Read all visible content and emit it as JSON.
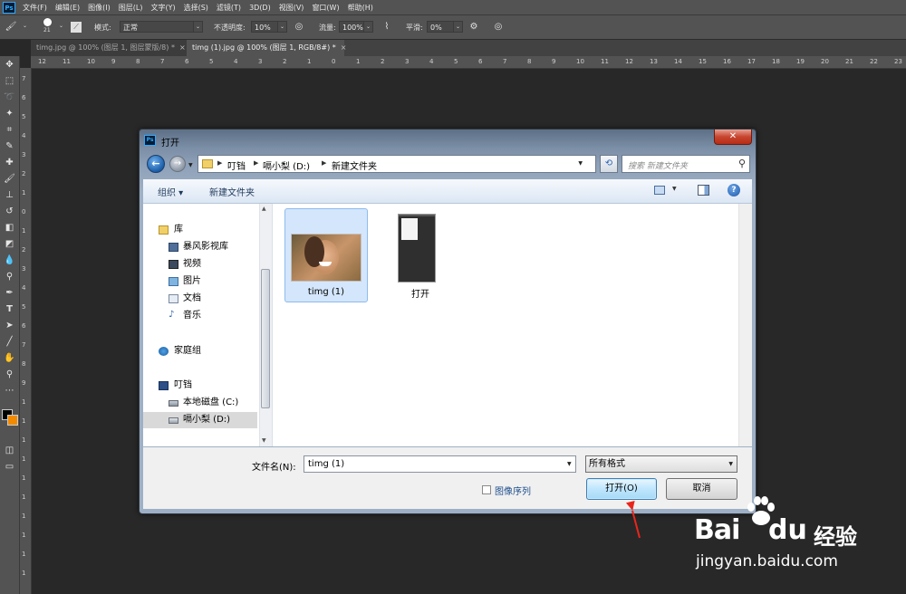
{
  "app": {
    "logo": "Ps",
    "menu": [
      "文件(F)",
      "编辑(E)",
      "图像(I)",
      "图层(L)",
      "文字(Y)",
      "选择(S)",
      "滤镜(T)",
      "3D(D)",
      "视图(V)",
      "窗口(W)",
      "帮助(H)"
    ]
  },
  "options": {
    "brush_size": "21",
    "mode_label": "模式:",
    "mode_value": "正常",
    "opacity_label": "不透明度:",
    "opacity_value": "10%",
    "flow_label": "流量:",
    "flow_value": "100%",
    "smooth_label": "平滑:",
    "smooth_value": "0%"
  },
  "tabs": [
    {
      "label": "timg.jpg @ 100% (图层 1, 图层蒙版/8) *",
      "close": "×"
    },
    {
      "label": "timg (1).jpg @ 100% (图层 1, RGB/8#) *",
      "close": "×"
    }
  ],
  "ruler": {
    "h_ticks": [
      "12",
      "11",
      "10",
      "9",
      "8",
      "7",
      "6",
      "5",
      "4",
      "3",
      "2",
      "1",
      "0",
      "1",
      "2",
      "3",
      "4",
      "5",
      "6",
      "7",
      "8",
      "9",
      "10",
      "11",
      "12",
      "13",
      "14",
      "15",
      "16",
      "17",
      "18",
      "19",
      "20",
      "21",
      "22",
      "23"
    ],
    "v_ticks": [
      "7",
      "6",
      "5",
      "4",
      "3",
      "2",
      "1",
      "0",
      "1",
      "2",
      "3",
      "4",
      "5",
      "6",
      "7",
      "8",
      "9",
      "1",
      "1",
      "1",
      "1",
      "1",
      "1",
      "1",
      "1",
      "1",
      "1"
    ]
  },
  "dialog": {
    "title": "打开",
    "close": "✕",
    "breadcrumb": [
      "叮铛",
      "嗝小梨 (D:)",
      "新建文件夹"
    ],
    "search_placeholder": "搜索 新建文件夹",
    "organize": "组织 ▾",
    "new_folder": "新建文件夹",
    "nav": [
      {
        "label": "库",
        "icon": "library-icon"
      },
      {
        "label": "暴风影视库",
        "icon": "video-library-icon"
      },
      {
        "label": "视频",
        "icon": "video-icon"
      },
      {
        "label": "图片",
        "icon": "picture-icon"
      },
      {
        "label": "文档",
        "icon": "document-icon"
      },
      {
        "label": "音乐",
        "icon": "music-icon"
      },
      {
        "label": "家庭组",
        "icon": "homegroup-icon"
      },
      {
        "label": "叮铛",
        "icon": "computer-icon"
      },
      {
        "label": "本地磁盘 (C:)",
        "icon": "disk-icon"
      },
      {
        "label": "嗝小梨 (D:)",
        "icon": "disk-icon"
      }
    ],
    "files": [
      {
        "name": "timg (1)"
      },
      {
        "name": "打开"
      }
    ],
    "filename_label": "文件名(N):",
    "filename_value": "timg (1)",
    "filetype": "所有格式",
    "image_sequence": "图像序列",
    "open_button": "打开(O)",
    "cancel_button": "取消"
  },
  "watermark": {
    "bai": "Bai",
    "du": "du",
    "jingyan": "经验",
    "url": "jingyan.baidu.com"
  },
  "colors": {
    "ps_bg": "#282828",
    "ps_panel": "#535353",
    "dialog_frame": "#8ea1b8",
    "open_button": "#bee6fd",
    "arrow": "#e8261c"
  }
}
